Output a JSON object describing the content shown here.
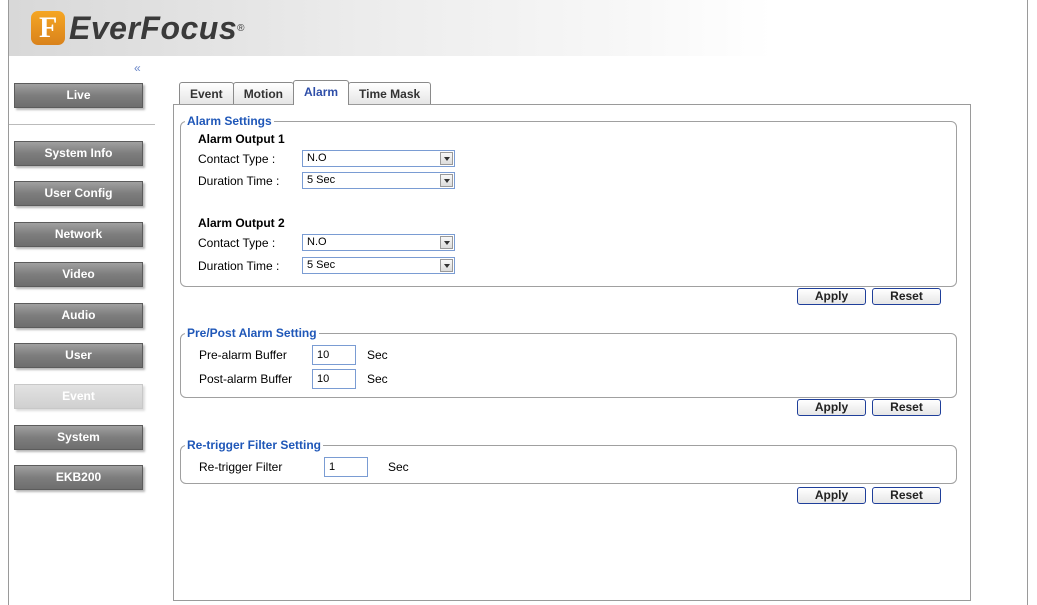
{
  "brand": {
    "logo_letter": "F",
    "name": "EverFocus",
    "registered": "®"
  },
  "sidebar": {
    "collapse_icon": "«",
    "items": [
      {
        "label": "Live",
        "active": false
      },
      {
        "label": "System Info",
        "active": false
      },
      {
        "label": "User Config",
        "active": false
      },
      {
        "label": "Network",
        "active": false
      },
      {
        "label": "Video",
        "active": false
      },
      {
        "label": "Audio",
        "active": false
      },
      {
        "label": "User",
        "active": false
      },
      {
        "label": "Event",
        "active": true
      },
      {
        "label": "System",
        "active": false
      },
      {
        "label": "EKB200",
        "active": false
      }
    ]
  },
  "tabs": [
    {
      "label": "Event",
      "active": false
    },
    {
      "label": "Motion",
      "active": false
    },
    {
      "label": "Alarm",
      "active": true
    },
    {
      "label": "Time Mask",
      "active": false
    }
  ],
  "alarm_settings": {
    "legend": "Alarm Settings",
    "output1": {
      "title": "Alarm Output 1",
      "contact_label": "Contact Type :",
      "contact_value": "N.O",
      "duration_label": "Duration Time :",
      "duration_value": "5 Sec"
    },
    "output2": {
      "title": "Alarm Output 2",
      "contact_label": "Contact Type :",
      "contact_value": "N.O",
      "duration_label": "Duration Time :",
      "duration_value": "5 Sec"
    },
    "apply": "Apply",
    "reset": "Reset"
  },
  "prepost": {
    "legend": "Pre/Post Alarm Setting",
    "pre_label": "Pre-alarm Buffer",
    "pre_value": "10",
    "post_label": "Post-alarm Buffer",
    "post_value": "10",
    "unit": "Sec",
    "apply": "Apply",
    "reset": "Reset"
  },
  "retrigger": {
    "legend": "Re-trigger Filter Setting",
    "label": "Re-trigger Filter",
    "value": "1",
    "unit": "Sec",
    "apply": "Apply",
    "reset": "Reset"
  }
}
